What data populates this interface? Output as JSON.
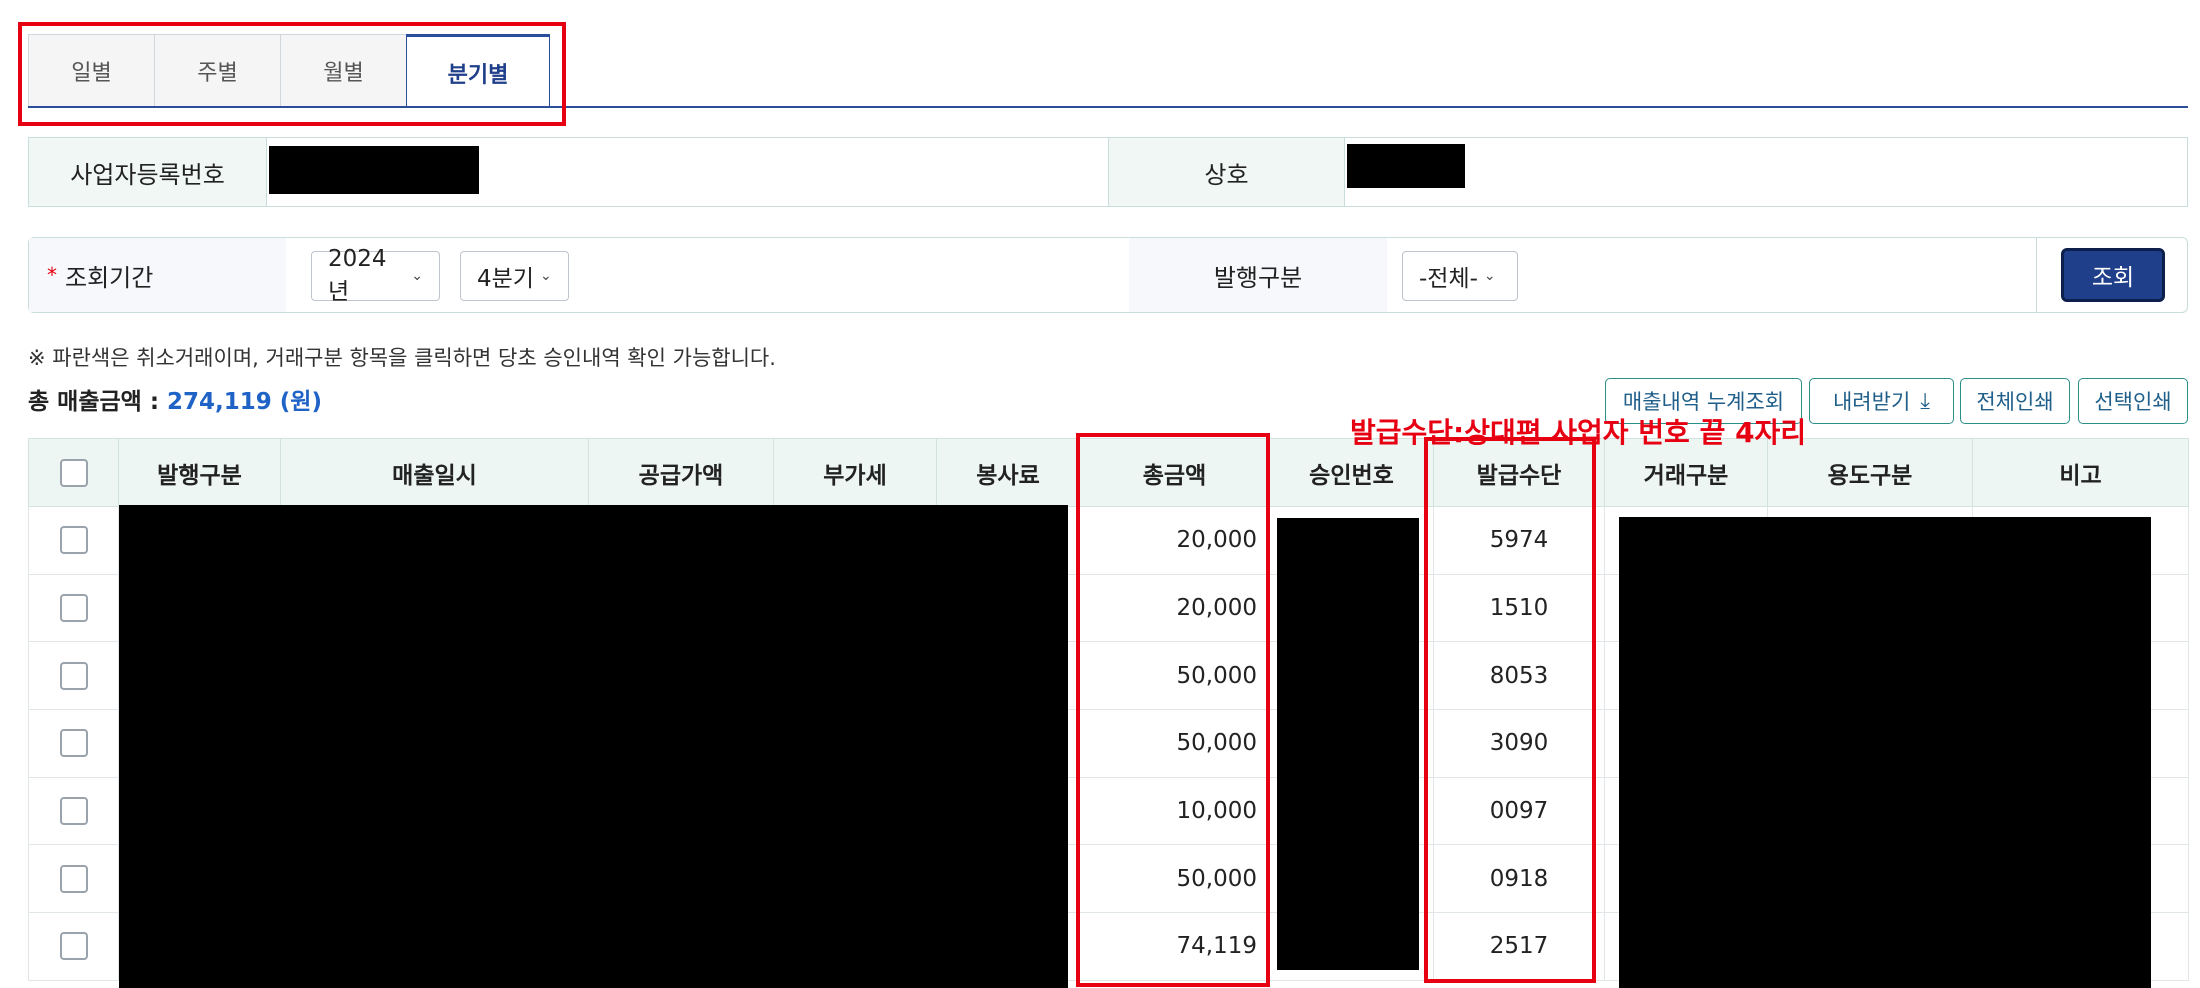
{
  "tabs": [
    {
      "label": "일별",
      "active": false
    },
    {
      "label": "주별",
      "active": false
    },
    {
      "label": "월별",
      "active": false
    },
    {
      "label": "분기별",
      "active": true
    }
  ],
  "info": {
    "business_number_label": "사업자등록번호",
    "company_name_label": "상호"
  },
  "search": {
    "period_label": "조회기간",
    "required_mark": "*",
    "year_value": "2024년",
    "quarter_value": "4분기",
    "issue_type_label": "발행구분",
    "issue_type_value": "-전체-",
    "search_button": "조회"
  },
  "notice": "※ 파란색은 취소거래이며, 거래구분 항목을 클릭하면 당초 승인내역 확인 가능합니다.",
  "total": {
    "label": "총 매출금액 : ",
    "amount": "274,119 (원)"
  },
  "actions": {
    "cumulative": "매출내역 누계조회",
    "download": "내려받기",
    "print_all": "전체인쇄",
    "print_selected": "선택인쇄"
  },
  "annotation": "발급수단:상대편 사업자 번호 끝 4자리",
  "table": {
    "headers": [
      "발행구분",
      "매출일시",
      "공급가액",
      "부가세",
      "봉사료",
      "총금액",
      "승인번호",
      "발급수단",
      "거래구분",
      "용도구분",
      "비고"
    ],
    "rows": [
      {
        "total": "20,000",
        "means": "5974"
      },
      {
        "total": "20,000",
        "means": "1510"
      },
      {
        "total": "50,000",
        "means": "8053"
      },
      {
        "total": "50,000",
        "means": "3090"
      },
      {
        "total": "10,000",
        "means": "0097"
      },
      {
        "total": "50,000",
        "means": "0918"
      },
      {
        "total": "74,119",
        "means": "2517"
      }
    ]
  },
  "colors": {
    "primary": "#1f3f8a",
    "accent_blue": "#1f63c6",
    "highlight_red": "#e60012",
    "header_bg": "#eef6f4"
  }
}
